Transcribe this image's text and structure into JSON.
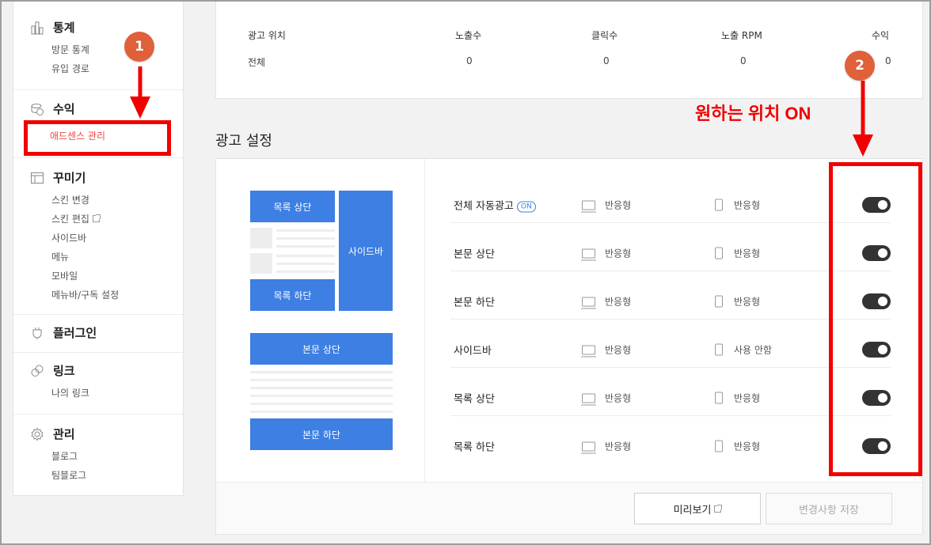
{
  "sidebar": {
    "groups": [
      {
        "title": "통계",
        "icon": "bar-chart-icon",
        "items": [
          "방문 통계",
          "유입 경로"
        ]
      },
      {
        "title": "수익",
        "icon": "coins-icon",
        "items": [
          "애드센스 관리"
        ]
      },
      {
        "title": "꾸미기",
        "icon": "layout-icon",
        "items": [
          "스킨 변경",
          "스킨 편집",
          "사이드바",
          "메뉴",
          "모바일",
          "메뉴바/구독 설정"
        ]
      },
      {
        "title": "플러그인",
        "icon": "plug-icon",
        "items": []
      },
      {
        "title": "링크",
        "icon": "link-icon",
        "items": [
          "나의 링크"
        ]
      },
      {
        "title": "관리",
        "icon": "gear-icon",
        "items": [
          "블로그",
          "팀블로그"
        ]
      }
    ],
    "active_item": "애드센스 관리",
    "active_color": "#f0483e"
  },
  "stats": {
    "headers": [
      "광고 위치",
      "노출수",
      "클릭수",
      "노출 RPM",
      "수익"
    ],
    "row": [
      "전체",
      "0",
      "0",
      "0",
      "0"
    ]
  },
  "ad_settings": {
    "title": "광고 설정",
    "preview": {
      "list_top": "목록 상단",
      "list_bottom": "목록 하단",
      "sidebar": "사이드바",
      "body_top": "본문 상단",
      "body_bottom": "본문 하단",
      "block_color": "#3d7fe3"
    },
    "rows": [
      {
        "name": "전체 자동광고",
        "badge": "ON",
        "pc": "반응형",
        "mobile": "반응형",
        "enabled": true
      },
      {
        "name": "본문 상단",
        "pc": "반응형",
        "mobile": "반응형",
        "enabled": true
      },
      {
        "name": "본문 하단",
        "pc": "반응형",
        "mobile": "반응형",
        "enabled": true
      },
      {
        "name": "사이드바",
        "pc": "반응형",
        "mobile": "사용 안함",
        "enabled": true
      },
      {
        "name": "목록 상단",
        "pc": "반응형",
        "mobile": "반응형",
        "enabled": true
      },
      {
        "name": "목록 하단",
        "pc": "반응형",
        "mobile": "반응형",
        "enabled": true
      }
    ],
    "buttons": {
      "preview": "미리보기",
      "save": "변경사항 저장"
    }
  },
  "annotations": {
    "step1": "1",
    "step2": "2",
    "label": "원하는 위치 ON",
    "color": "#f10000"
  }
}
